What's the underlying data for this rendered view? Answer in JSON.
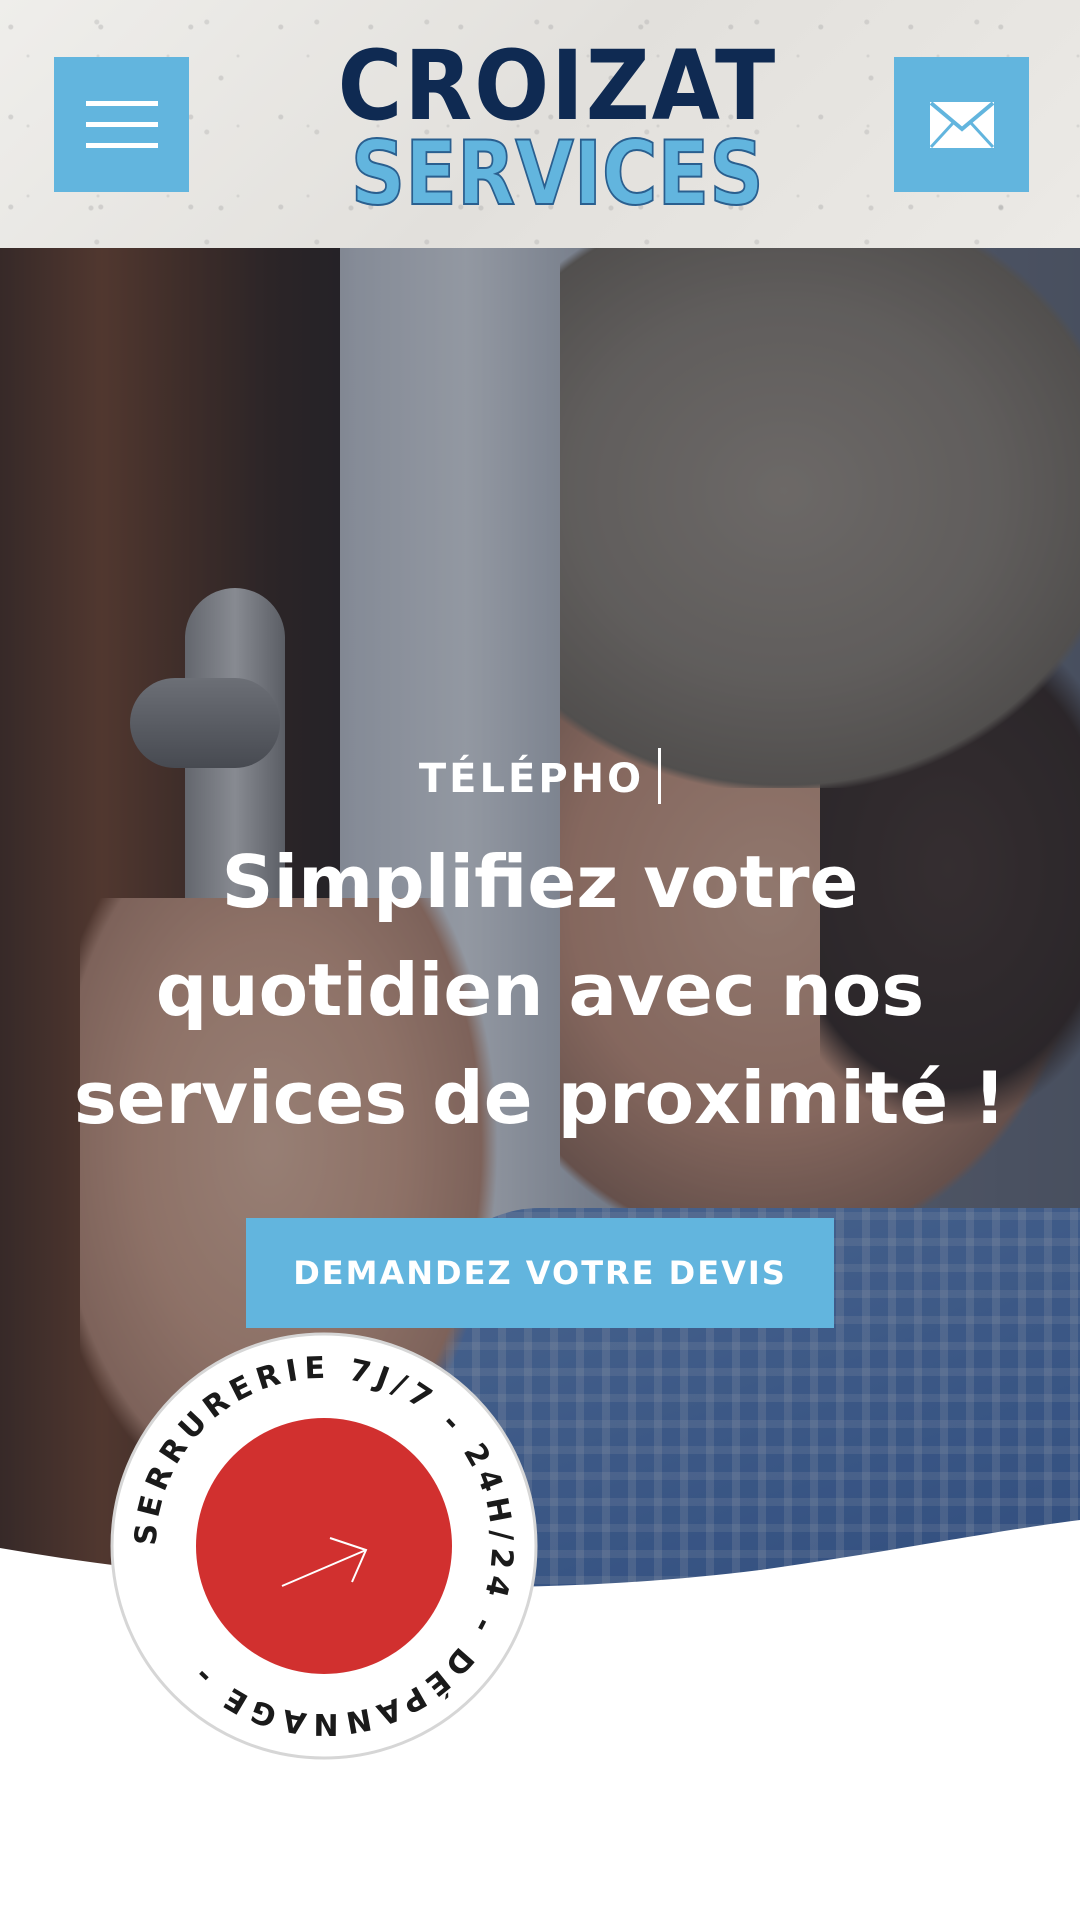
{
  "header": {
    "logo": {
      "line1": "CROIZAT",
      "line2": "SERVICES"
    },
    "menu_icon": "hamburger-menu-icon",
    "mail_icon": "envelope-icon"
  },
  "hero": {
    "eyebrow": "TÉLÉPHO",
    "headline_lines": [
      "Simplifiez votre",
      "quotidien avec nos",
      "services de proximité !"
    ],
    "cta_label": "DEMANDEZ VOTRE DEVIS"
  },
  "badge": {
    "ring_text": "SERRURERIE 7J/7 - 24H/24 - DÉPANNAGE -",
    "arrow_icon": "arrow-up-right-icon"
  },
  "colors": {
    "accent_blue": "#62b5de",
    "navy": "#0f2a52",
    "badge_red": "#d1302f"
  }
}
